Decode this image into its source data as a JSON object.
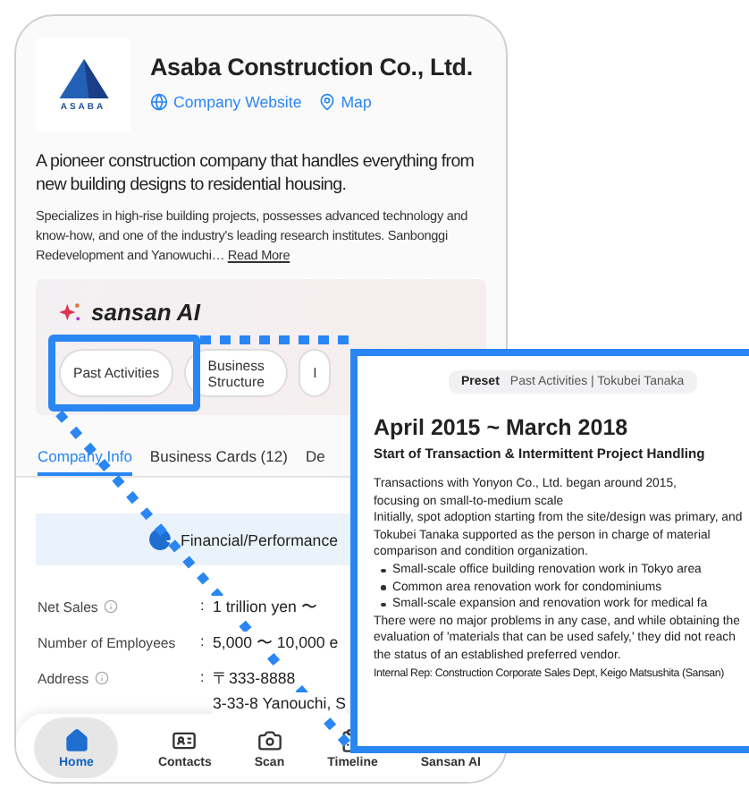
{
  "company": {
    "logo_text": "ASABA",
    "name": "Asaba Construction Co., Ltd.",
    "links": [
      {
        "label": "Company Website",
        "kind": "web"
      },
      {
        "label": "Map",
        "kind": "map"
      }
    ],
    "headline": "A pioneer construction company that handles everything from new building designs to residential housing.",
    "description": "Specializes in high-rise building projects, possesses advanced technology and know-how, and one of the industry's leading research institutes. Sanbonggi Redevelopment and Yanowuchi…",
    "read_more": "Read More"
  },
  "ai_panel": {
    "title": "sansan AI",
    "chips": [
      {
        "label": "Past Activities"
      },
      {
        "label": "Business Structure"
      },
      {
        "label": "I"
      }
    ]
  },
  "tabs": [
    {
      "label": "Company Info",
      "selected": true
    },
    {
      "label": "Business Cards (12)",
      "selected": false
    },
    {
      "label": "De",
      "selected": false
    }
  ],
  "section_banner": "Financial/Performance",
  "fields": [
    {
      "label": "Net Sales",
      "info": true,
      "separator": ":",
      "lines": [
        "1 trillion yen 〜"
      ]
    },
    {
      "label": "Number of Employees",
      "info": false,
      "separator": ":",
      "lines": [
        "5,000 〜 10,000 e"
      ]
    },
    {
      "label": "Address",
      "info": true,
      "separator": ":",
      "lines": [
        "〒333-8888",
        "3-33-8 Yanouchi, S"
      ]
    }
  ],
  "nav": [
    {
      "label": "Home",
      "kind": "home",
      "selected": true
    },
    {
      "label": "Contacts",
      "kind": "contacts",
      "selected": false
    },
    {
      "label": "Scan",
      "kind": "scan",
      "selected": false
    },
    {
      "label": "Timeline",
      "kind": "timeline",
      "selected": false
    },
    {
      "label": "Sansan AI",
      "kind": "ai",
      "selected": false
    }
  ],
  "popup": {
    "preset_tag": "Preset",
    "preset_text": "Past Activities | Tokubei Tanaka",
    "period": "April 2015 ~ March 2018",
    "subtitle": "Start of Transaction & Intermittent Project Handling",
    "intro": [
      "Transactions with Yonyon Co., Ltd. began around 2015, focusing on small-to-medium scale",
      "Initially, spot adoption starting from the site/design was primary, and Tokubei Tanaka supported as the person in charge of material comparison and condition organization."
    ],
    "bullets": [
      "Small-scale office building renovation work in Tokyo area",
      "Common area renovation work for condominiums",
      "Small-scale expansion and renovation work for medical fa"
    ],
    "closing": "There were no major problems in any case, and while obtaining the evaluation of 'materials that can be used safely,' they did not reach the status of an established preferred vendor.",
    "footer": "Internal Rep: Construction Corporate Sales Dept, Keigo Matsushita (Sansan)"
  }
}
